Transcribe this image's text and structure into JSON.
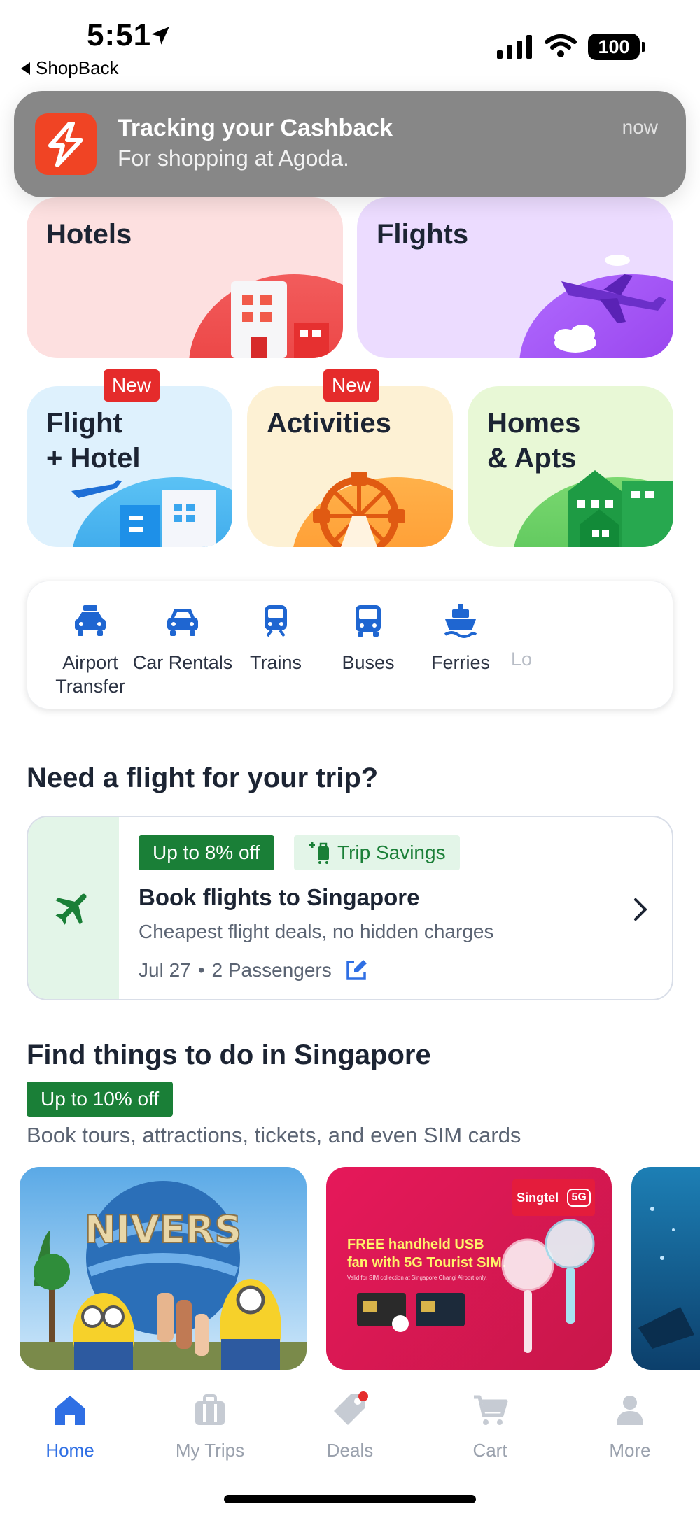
{
  "status_bar": {
    "time": "5:51",
    "back_app": "ShopBack",
    "battery": "100"
  },
  "notification": {
    "title": "Tracking your Cashback",
    "body": "For shopping at Agoda.",
    "time": "now"
  },
  "categories": {
    "hotels": "Hotels",
    "flights": "Flights",
    "flight_hotel": "Flight\n+ Hotel",
    "activities": "Activities",
    "homes": "Homes\n& Apts",
    "new_badge": "New"
  },
  "transport": {
    "items": [
      {
        "label": "Airport\nTransfer",
        "icon": "taxi-icon"
      },
      {
        "label": "Car Rentals",
        "icon": "car-icon"
      },
      {
        "label": "Trains",
        "icon": "train-icon"
      },
      {
        "label": "Buses",
        "icon": "bus-icon"
      },
      {
        "label": "Ferries",
        "icon": "ferry-icon"
      },
      {
        "label": "Lo",
        "icon": ""
      }
    ]
  },
  "flight_section": {
    "heading": "Need a flight for your trip?",
    "discount": "Up to 8% off",
    "savings": "Trip Savings",
    "title": "Book flights to Singapore",
    "subtitle": "Cheapest flight deals, no hidden charges",
    "date": "Jul 27",
    "passengers": "2 Passengers"
  },
  "activities_section": {
    "heading": "Find things to do in Singapore",
    "discount": "Up to 10% off",
    "subtitle": "Book tours, attractions, tickets, and even SIM cards",
    "card2": {
      "brand": "Singtel",
      "badge": "5G",
      "headline": "FREE handheld USB fan with 5G Tourist SIM.",
      "fineprint": "Valid for SIM collection at Singapore Changi Airport only."
    }
  },
  "bottom_nav": {
    "items": [
      {
        "label": "Home"
      },
      {
        "label": "My Trips"
      },
      {
        "label": "Deals"
      },
      {
        "label": "Cart"
      },
      {
        "label": "More"
      }
    ]
  },
  "colors": {
    "accent_blue": "#2f6fe4",
    "green": "#1a7f37",
    "badge_red": "#e52b2b"
  }
}
